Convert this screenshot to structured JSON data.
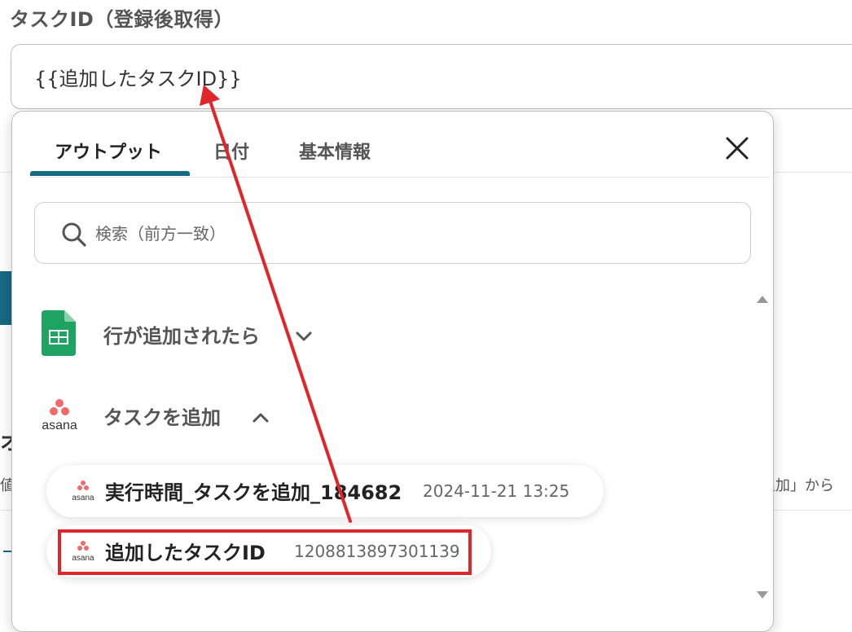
{
  "field": {
    "label": "タスクID（登録後取得）",
    "value": "{{追加したタスクID}}"
  },
  "background": {
    "left_glyph": "オ",
    "left_text": "値",
    "right_text": "追加」から"
  },
  "popup": {
    "tabs": [
      {
        "label": "アウトプット",
        "active": true
      },
      {
        "label": "日付",
        "active": false
      },
      {
        "label": "基本情報",
        "active": false
      }
    ],
    "search_placeholder": "検索（前方一致）",
    "sections": [
      {
        "title": "行が追加されたら",
        "icon": "google-sheets-icon",
        "expanded": false
      },
      {
        "title": "タスクを追加",
        "icon": "asana-logo",
        "logo_text": "asana",
        "expanded": true,
        "items": [
          {
            "name": "実行時間_タスクを追加_184682",
            "value": "2024-11-21 13:25"
          },
          {
            "name": "追加したタスクID",
            "value": "1208813897301139"
          }
        ]
      }
    ]
  },
  "colors": {
    "accent": "#166a82",
    "highlight": "#e0262a",
    "sheets_green": "#1ea362",
    "asana_pink": "#f06a6a"
  }
}
